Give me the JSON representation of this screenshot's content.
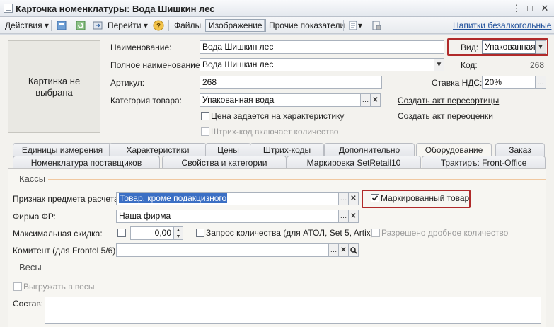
{
  "window": {
    "title": "Карточка номенклатуры: Вода Шишкин лес"
  },
  "toolbar": {
    "actions_label": "Действия",
    "goto_label": "Перейти",
    "files_label": "Файлы",
    "image_label": "Изображение",
    "other_label": "Прочие показатели",
    "cashless_link": "Напитки безалкогольные"
  },
  "picture": {
    "placeholder": "Картинка не выбрана"
  },
  "form": {
    "name_label": "Наименование:",
    "name_value": "Вода Шишкин лес",
    "fullname_label": "Полное наименование:",
    "fullname_value": "Вода Шишкин лес",
    "article_label": "Артикул:",
    "article_value": "268",
    "category_label": "Категория товара:",
    "category_value": "Упакованная вода",
    "price_by_char_label": "Цена задается на характеристику",
    "barcode_qty_label": "Штрих-код включает количество",
    "kind_label": "Вид:",
    "kind_value": "Упакованная",
    "code_label": "Код:",
    "code_value": "268",
    "vat_label": "Ставка НДС:",
    "vat_value": "20%",
    "create_regrade_link": "Создать акт пересортицы",
    "create_reprice_link": "Создать акт переоценки"
  },
  "tabs": {
    "row1": [
      "Единицы измерения",
      "Характеристики",
      "Цены",
      "Штрих-коды",
      "Дополнительно",
      "Оборудование",
      "Заказ"
    ],
    "row2": [
      "Номенклатура поставщиков",
      "Свойства и категории",
      "Маркировка SetRetail10",
      "Трактиръ: Front-Office"
    ],
    "active": "Оборудование"
  },
  "equipment": {
    "cash_group": "Кассы",
    "subject_label": "Признак предмета расчета:",
    "subject_value": "Товар, кроме подакцизного",
    "marked_label": "Маркированный товар",
    "firm_label": "Фирма ФР:",
    "firm_value": "Наша фирма",
    "max_discount_label": "Максимальная скидка:",
    "max_discount_value": "0,00",
    "qty_request_label": "Запрос количества (для АТОЛ, Set 5, Artix)",
    "fraction_label": "Разрешено дробное количество",
    "committent_label": "Комитент (для Frontol 5/6):",
    "committent_value": "",
    "scales_group": "Весы",
    "upload_scales_label": "Выгружать в весы",
    "composition_label": "Состав:",
    "composition_value": ""
  }
}
